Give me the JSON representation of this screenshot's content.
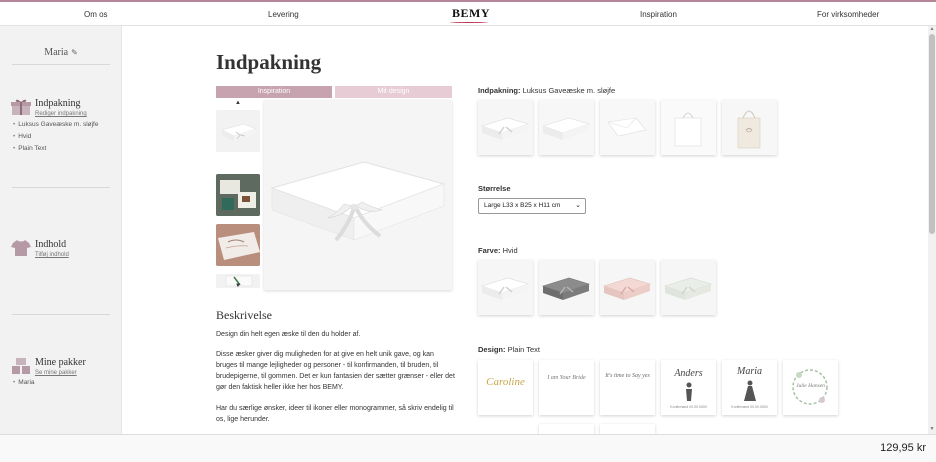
{
  "nav": {
    "links": [
      "Om os",
      "Levering",
      "Inspiration",
      "For virksomheder"
    ],
    "logo": "BEMY"
  },
  "sidebar": {
    "user_name": "Maria",
    "sections": [
      {
        "title": "Indpakning",
        "link": "Rediger indpakning",
        "items": [
          "Luksus Gaveæske m. sløjfe",
          "Hvid",
          "Plain Text"
        ]
      },
      {
        "title": "Indhold",
        "link": "Tilføj indhold",
        "items": []
      },
      {
        "title": "Mine pakker",
        "link": "Se mine pakker",
        "items": [
          "Maria"
        ]
      }
    ]
  },
  "main": {
    "title": "Indpakning",
    "tabs": [
      "Inspiration",
      "Mit design"
    ],
    "description": {
      "title": "Beskrivelse",
      "p1": "Design din helt egen æske til den du holder af.",
      "p2": "Disse æsker giver dig muligheden for at give en helt unik gave, og kan bruges til mange lejligheder og personer - til konfirmanden, til bruden, til brudepigerne, til gommen. Det er kun fantasien der sætter grænser - eller det gør den faktisk heller ikke her hos BEMY.",
      "p3": "Har du særlige ønsker, ideer til ikoner eller monogrammer, så skriv endelig til os, lige herunder."
    }
  },
  "options": {
    "packaging": {
      "label": "Indpakning:",
      "value": "Luksus Gaveæske m. sløjfe"
    },
    "size": {
      "label": "Størrelse",
      "value": "Large L33 x B25 x H11 cm"
    },
    "color": {
      "label": "Farve:",
      "value": "Hvid"
    },
    "design": {
      "label": "Design:",
      "value": "Plain Text"
    },
    "design_texts": [
      "Caroline",
      "I am Your Bride",
      "It's time to Say yes",
      "Anders",
      "Maria",
      "Julie Hansen"
    ],
    "design_dates": [
      "Konfirmand 00.00.0000",
      "Konfirmand 00.00.0000"
    ],
    "swatch_colors": [
      "#ffffff",
      "#8a8a8a",
      "#f1d6d3",
      "#e8ece6"
    ]
  },
  "footer": {
    "price": "129,95 kr"
  },
  "colors": {
    "accent": "#b4869a",
    "tab_active": "#c6a3ae",
    "tab_inactive": "#e8ccd5"
  }
}
